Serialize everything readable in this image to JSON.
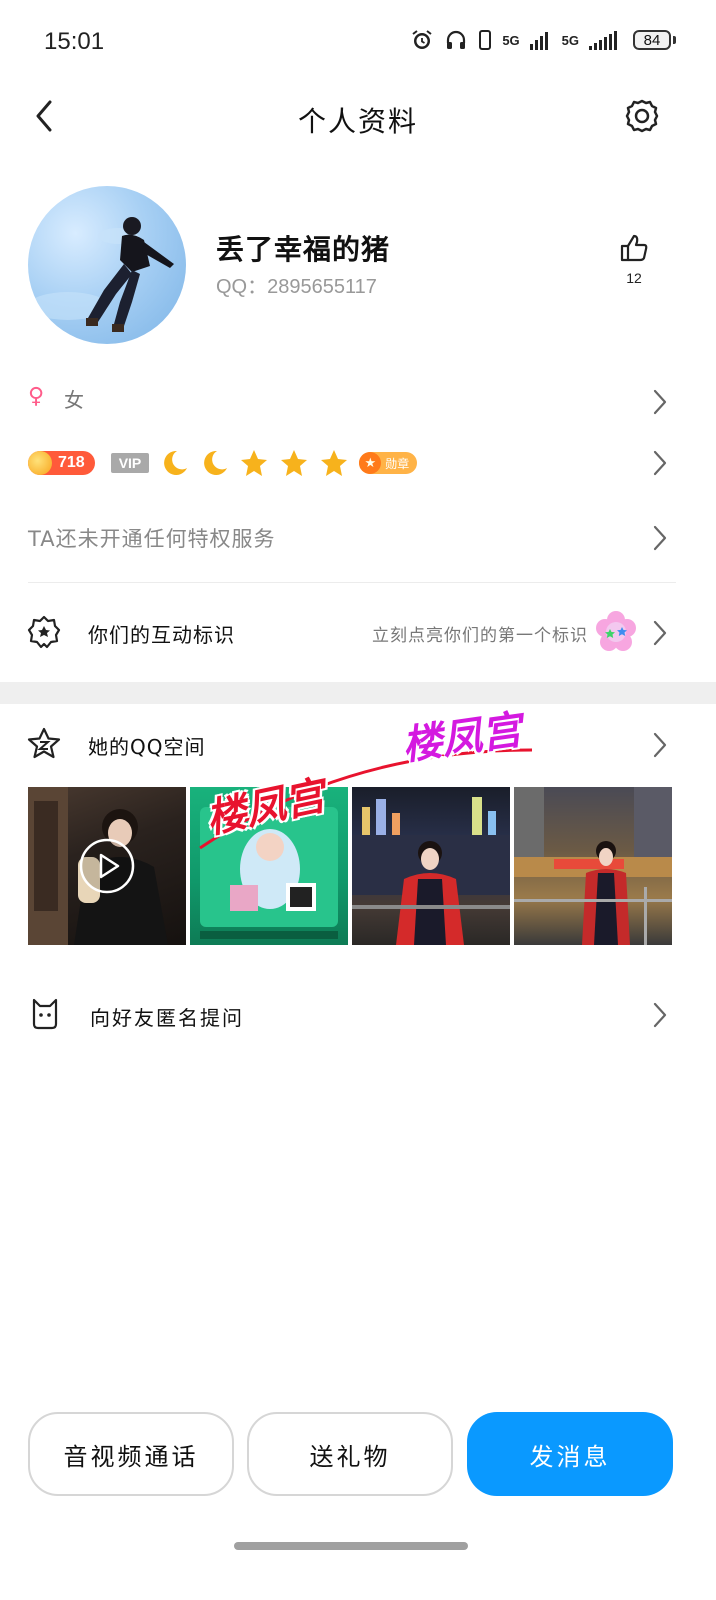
{
  "status_bar": {
    "time": "15:01",
    "network_1": "5G",
    "network_2": "5G",
    "battery": "84"
  },
  "nav": {
    "title": "个人资料"
  },
  "profile": {
    "nickname": "丢了幸福的猪",
    "qq_label": "QQ：2895655117",
    "like_count": "12"
  },
  "info_rows": {
    "gender_symbol": "♀",
    "gender": "女",
    "level": "718",
    "vip": "VIP",
    "medal_label": "勋章",
    "privilege_text": "TA还未开通任何特权服务"
  },
  "interaction": {
    "title": "你们的互动标识",
    "hint": "立刻点亮你们的第一个标识"
  },
  "qzone": {
    "title": "她的QQ空间",
    "watermark": "楼凤宫"
  },
  "ask": {
    "title": "向好友匿名提问"
  },
  "actions": {
    "call": "音视频通话",
    "gift": "送礼物",
    "message": "发消息"
  },
  "colors": {
    "accent": "#0a99ff",
    "level_pill": "#ff5a3a",
    "gender_icon": "#ff5c8a",
    "watermark_red": "#e8132e",
    "watermark_magenta": "#d419e0"
  },
  "icons": {
    "status": [
      "alarm-icon",
      "headphones-icon",
      "vibrate-icon",
      "signal-icon",
      "battery-icon"
    ],
    "nav": [
      "back-arrow-icon",
      "settings-gear-icon"
    ],
    "rows": [
      "thumbs-up-icon",
      "female-icon",
      "badge-star-icon",
      "qzone-star-icon",
      "anonymous-cat-icon",
      "chevron-right-icon",
      "play-icon"
    ]
  }
}
